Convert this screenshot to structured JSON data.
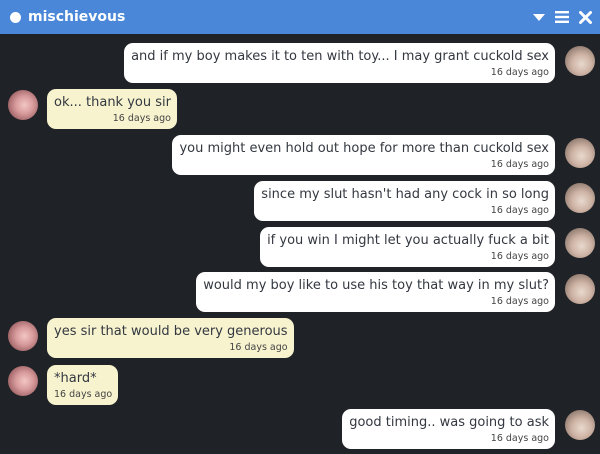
{
  "header": {
    "contact_name": "mischievous",
    "status_color": "#ffffff",
    "bar_color": "#4a87d8",
    "controls": [
      "chevron-down-icon",
      "menu-icon",
      "close-icon"
    ]
  },
  "messages": [
    {
      "sender": "self",
      "text": "and if my boy makes it to ten with toy... I may grant cuckold sex",
      "time": "16 days ago"
    },
    {
      "sender": "contact",
      "text": "ok... thank you sir",
      "time": "16 days ago"
    },
    {
      "sender": "self",
      "text": "you might even hold out hope for more than cuckold sex",
      "time": "16 days ago"
    },
    {
      "sender": "self",
      "text": "since my slut hasn't had any cock in so long",
      "time": "16 days ago"
    },
    {
      "sender": "self",
      "text": "if you win I might let you actually fuck a bit",
      "time": "16 days ago"
    },
    {
      "sender": "self",
      "text": "would my boy like to use his toy that way in my slut?",
      "time": "16 days ago"
    },
    {
      "sender": "contact",
      "text": "yes sir that would be very generous",
      "time": "16 days ago"
    },
    {
      "sender": "contact",
      "text": "*hard*",
      "time": "16 days ago"
    },
    {
      "sender": "self",
      "text": "good timing.. was going to ask",
      "time": "16 days ago"
    }
  ]
}
